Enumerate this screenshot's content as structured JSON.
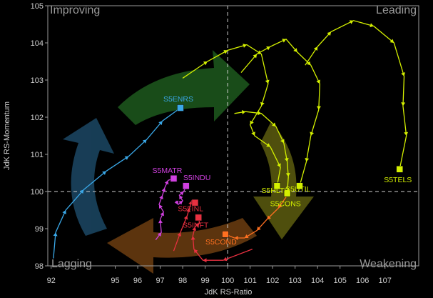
{
  "chart_data": {
    "type": "scatter",
    "subtype": "relative-rotation-graph",
    "xlabel": "JdK RS-Ratio",
    "ylabel": "JdK RS-Momentum",
    "xlim": [
      92,
      108.5
    ],
    "ylim": [
      98,
      105
    ],
    "x_ticks": [
      "92",
      "95",
      "96",
      "97",
      "98",
      "99",
      "100",
      "101",
      "102",
      "103",
      "104",
      "105",
      "106",
      "107"
    ],
    "x_tick_values": [
      92.15,
      95,
      96,
      97,
      98,
      99,
      100,
      101,
      102,
      103,
      104,
      105,
      106,
      107
    ],
    "y_ticks": [
      "98",
      "99",
      "100",
      "101",
      "102",
      "103",
      "104",
      "105"
    ],
    "y_tick_values": [
      98,
      99,
      100,
      101,
      102,
      103,
      104,
      105
    ],
    "center": [
      100,
      100
    ],
    "quadrants": [
      {
        "name": "Improving",
        "position": "top-left"
      },
      {
        "name": "Leading",
        "position": "top-right"
      },
      {
        "name": "Lagging",
        "position": "bottom-left"
      },
      {
        "name": "Weakening",
        "position": "bottom-right"
      }
    ],
    "rotation_arrow_colors": {
      "improving": "#3c9a3c",
      "leading": "#8a8a1c",
      "weakening": "#b87a16",
      "lagging": "#b04a26",
      "lagging_blue": "#2b6f9c"
    },
    "grid": false,
    "series": [
      {
        "name": "S5ENRS",
        "color": "#3aa8e8",
        "points": [
          [
            92.25,
            98.2
          ],
          [
            92.35,
            98.9
          ],
          [
            92.8,
            99.5
          ],
          [
            93.6,
            100.05
          ],
          [
            94.6,
            100.55
          ],
          [
            95.6,
            100.95
          ],
          [
            96.4,
            101.4
          ],
          [
            97.1,
            101.9
          ],
          [
            97.9,
            102.25
          ]
        ]
      },
      {
        "name": "S5MATR",
        "color": "#d040e0",
        "points": [
          [
            96.8,
            98.7
          ],
          [
            97.05,
            98.9
          ],
          [
            97.0,
            99.25
          ],
          [
            97.15,
            99.45
          ],
          [
            96.95,
            99.65
          ],
          [
            97.1,
            99.9
          ],
          [
            97.2,
            100.1
          ],
          [
            97.35,
            100.3
          ],
          [
            97.6,
            100.35
          ]
        ]
      },
      {
        "name": "S5INDU",
        "color": "#d040e0",
        "points": [
          [
            97.7,
            99.75
          ],
          [
            97.8,
            99.65
          ],
          [
            98.0,
            99.75
          ],
          [
            97.85,
            99.9
          ],
          [
            98.05,
            100.0
          ],
          [
            98.15,
            100.15
          ]
        ]
      },
      {
        "name": "S5FINL",
        "color": "#e83040",
        "points": [
          [
            97.6,
            98.4
          ],
          [
            97.9,
            98.9
          ],
          [
            98.2,
            99.35
          ],
          [
            98.3,
            99.55
          ],
          [
            98.4,
            99.75
          ],
          [
            98.55,
            99.7
          ]
        ]
      },
      {
        "name": "S5INFT",
        "color": "#e83040",
        "points": [
          [
            101.1,
            98.45
          ],
          [
            99.8,
            98.15
          ],
          [
            98.9,
            98.15
          ],
          [
            98.5,
            98.45
          ],
          [
            98.45,
            98.8
          ],
          [
            98.55,
            99.05
          ],
          [
            98.75,
            99.15
          ],
          [
            98.7,
            99.3
          ]
        ]
      },
      {
        "name": "S5COND",
        "color": "#ff7020",
        "points": [
          [
            102.6,
            99.85
          ],
          [
            102.25,
            99.55
          ],
          [
            101.75,
            99.25
          ],
          [
            101.3,
            98.95
          ],
          [
            100.75,
            98.75
          ],
          [
            100.3,
            98.75
          ],
          [
            99.9,
            98.85
          ]
        ]
      },
      {
        "name": "S5HLTH",
        "color": "#d4f000",
        "points": [
          [
            98.0,
            103.05
          ],
          [
            99.1,
            103.5
          ],
          [
            100.0,
            103.8
          ],
          [
            100.85,
            103.95
          ],
          [
            101.5,
            103.7
          ],
          [
            101.8,
            102.9
          ],
          [
            101.5,
            102.3
          ],
          [
            101.0,
            101.8
          ],
          [
            101.2,
            101.5
          ],
          [
            101.9,
            101.2
          ],
          [
            102.35,
            100.65
          ],
          [
            102.2,
            100.15
          ]
        ]
      },
      {
        "name": "S5CONS",
        "color": "#d4f000",
        "points": [
          [
            100.3,
            102.1
          ],
          [
            100.8,
            102.15
          ],
          [
            101.5,
            102.1
          ],
          [
            102.15,
            101.75
          ],
          [
            102.5,
            101.3
          ],
          [
            102.65,
            100.8
          ],
          [
            102.7,
            100.4
          ],
          [
            102.65,
            99.95
          ]
        ]
      },
      {
        "name": "S5UTIL",
        "color": "#d4f000",
        "points": [
          [
            100.6,
            103.2
          ],
          [
            101.3,
            103.7
          ],
          [
            101.9,
            103.9
          ],
          [
            102.6,
            104.1
          ],
          [
            103.1,
            103.75
          ],
          [
            103.7,
            103.4
          ],
          [
            104.1,
            102.9
          ],
          [
            104.05,
            102.2
          ],
          [
            103.7,
            101.5
          ],
          [
            103.5,
            100.8
          ],
          [
            103.2,
            100.15
          ]
        ]
      },
      {
        "name": "S5TELS",
        "color": "#d4f000",
        "points": [
          [
            103.45,
            103.4
          ],
          [
            104.0,
            103.9
          ],
          [
            104.6,
            104.3
          ],
          [
            105.6,
            104.6
          ],
          [
            106.5,
            104.45
          ],
          [
            107.4,
            104.0
          ],
          [
            107.85,
            103.1
          ],
          [
            107.8,
            102.3
          ],
          [
            107.95,
            101.5
          ],
          [
            107.65,
            100.6
          ]
        ]
      }
    ],
    "end_labels": [
      {
        "name": "S5ENRS",
        "color": "#3aa8e8"
      },
      {
        "name": "S5MATR",
        "color": "#d040e0"
      },
      {
        "name": "S5INDU",
        "color": "#d040e0"
      },
      {
        "name": "S5FINL",
        "color": "#e83040"
      },
      {
        "name": "S5INFT",
        "color": "#e83040"
      },
      {
        "name": "S5COND",
        "color": "#ff7020"
      },
      {
        "name": "S5HLTH",
        "color": "#d4f000"
      },
      {
        "name": "S5CONS",
        "color": "#d4f000"
      },
      {
        "name": "S5UTIL",
        "color": "#d4f000"
      },
      {
        "name": "S5TELS",
        "color": "#d4f000"
      }
    ]
  }
}
